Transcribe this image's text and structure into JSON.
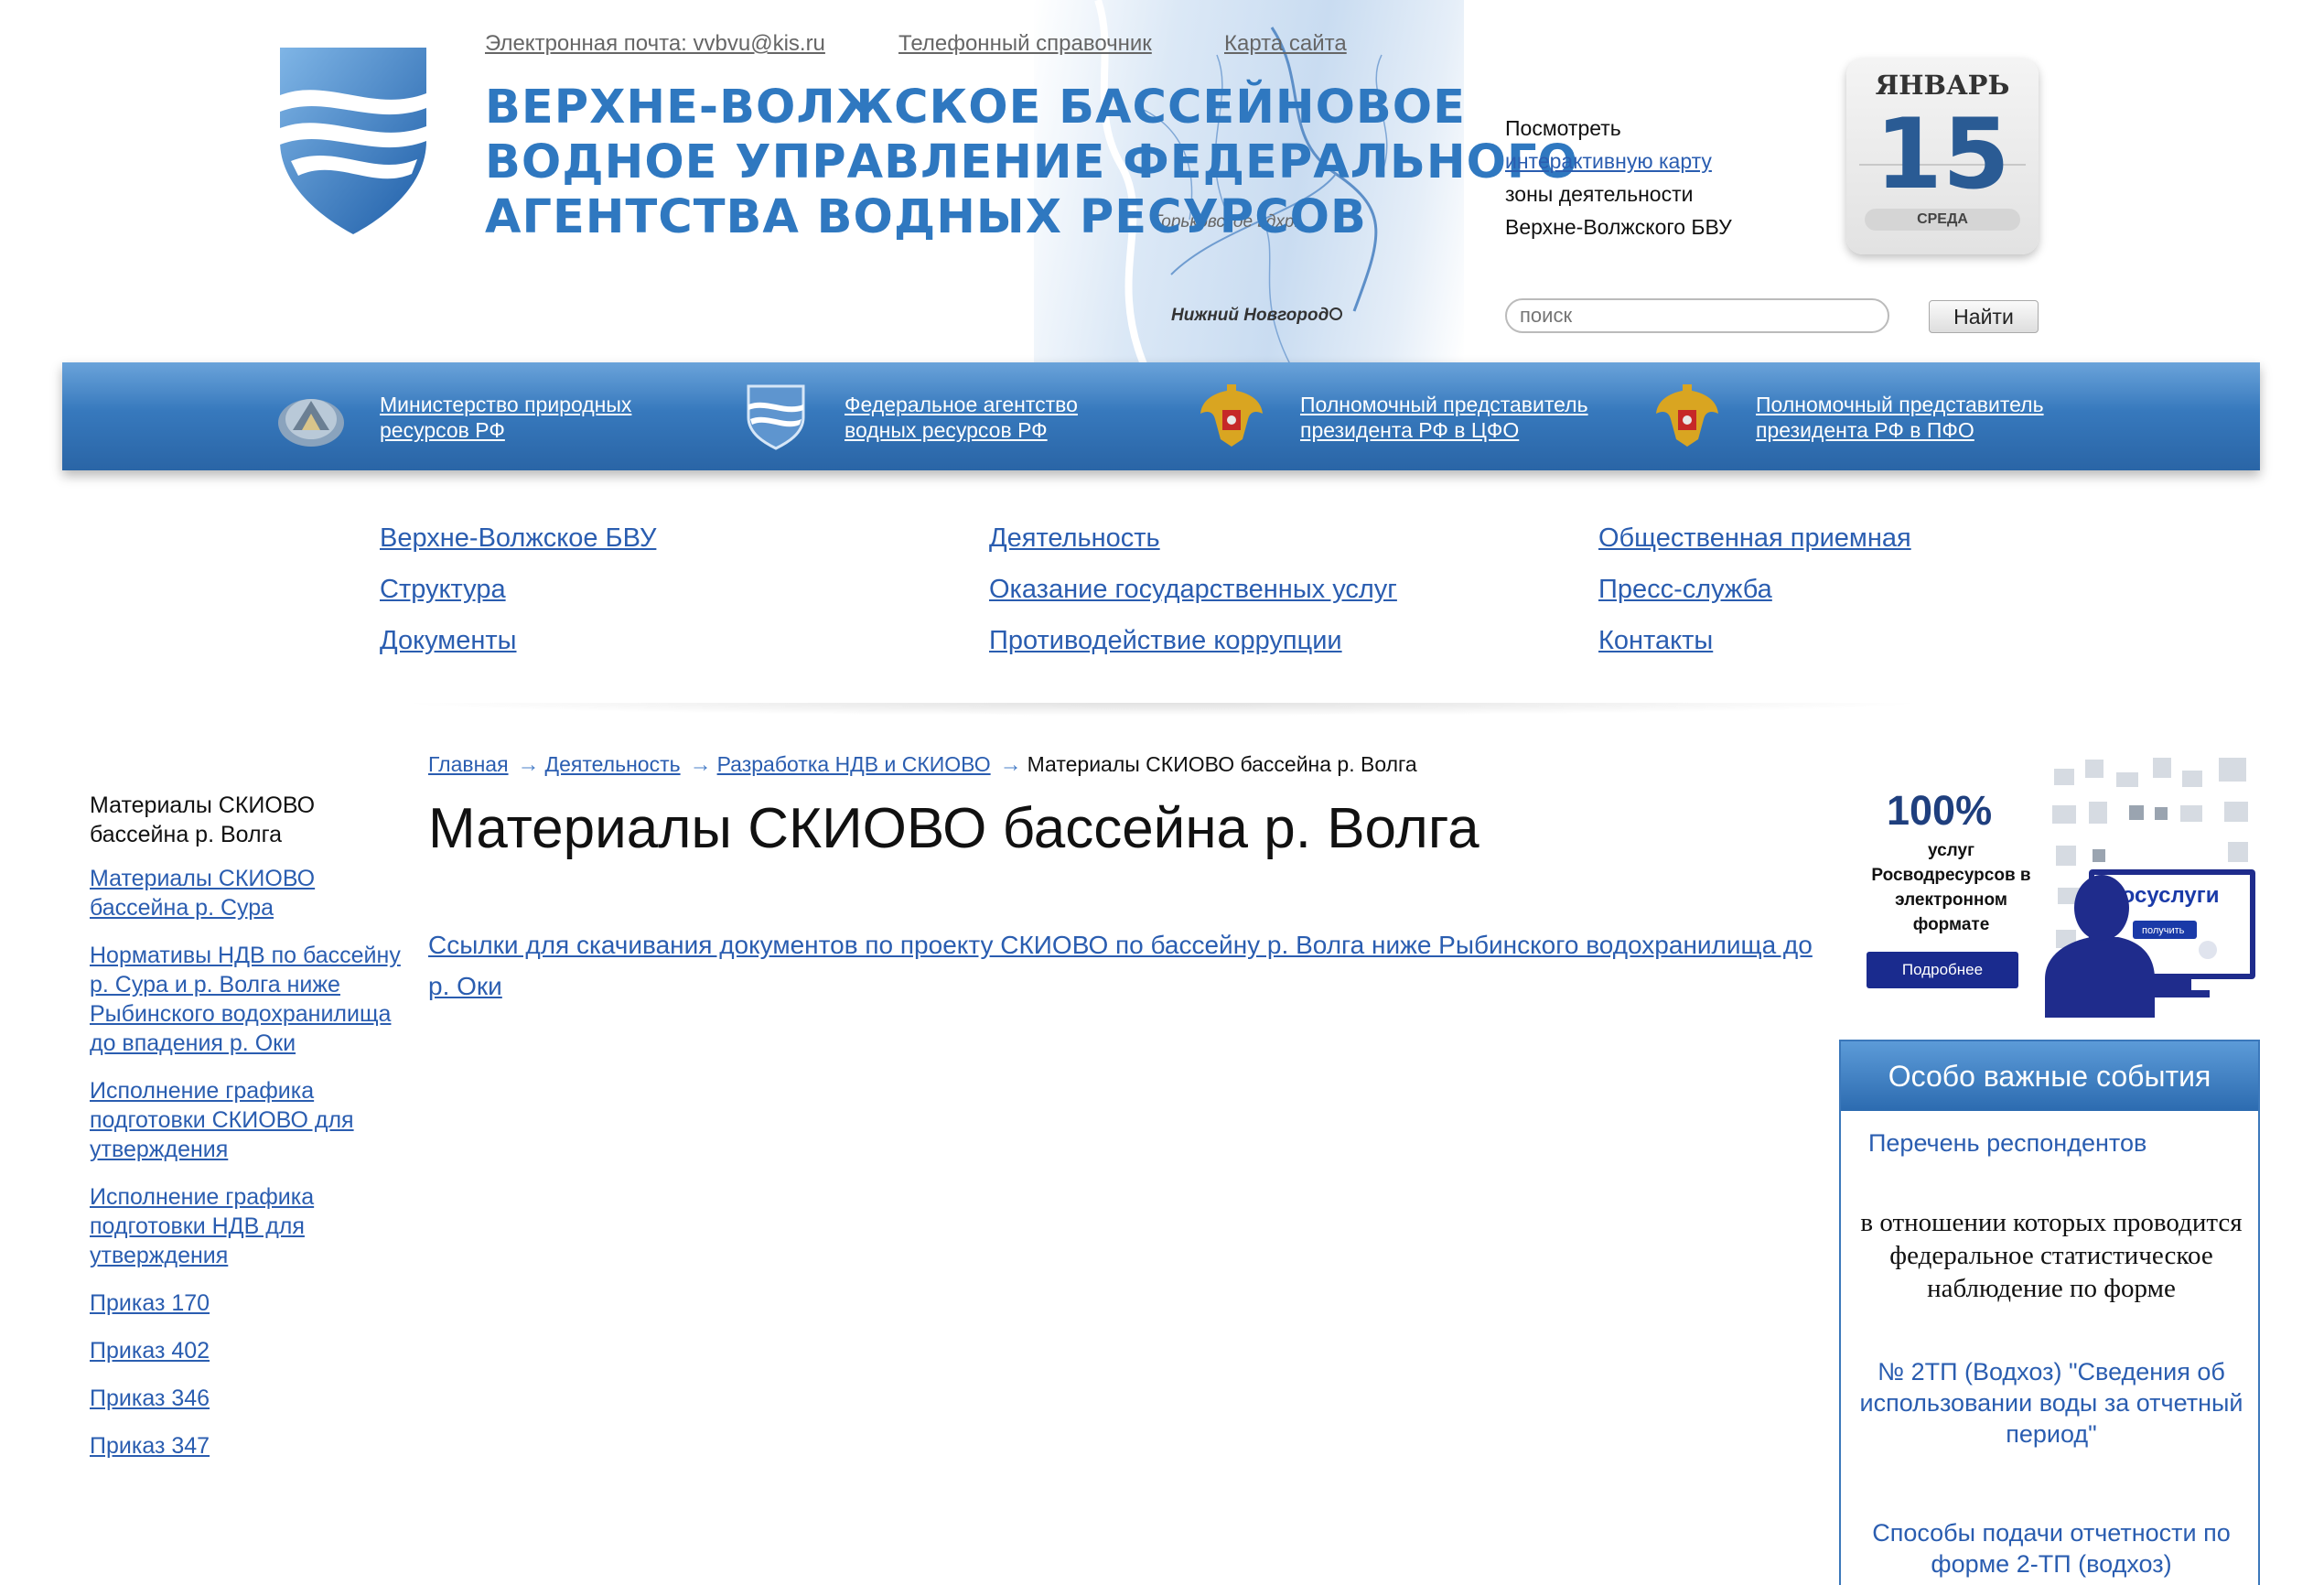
{
  "header": {
    "email_link": "Электронная почта: vvbvu@kis.ru",
    "phonebook_link": "Телефонный справочник",
    "sitemap_link": "Карта сайта",
    "title_lines": [
      "ВЕРХНЕ-ВОЛЖСКОЕ БАССЕЙНОВОЕ",
      "ВОДНОЕ УПРАВЛЕНИЕ ФЕДЕРАЛЬНОГО",
      "АГЕНТСТВА ВОДНЫХ РЕСУРСОВ"
    ],
    "map_labels": {
      "city": "Нижний Новгород",
      "reservoir": "Горьковское вдхр."
    },
    "map_info": {
      "line1": "Посмотреть",
      "link": "интерактивную карту",
      "line3": "зоны деятельности",
      "line4": "Верхне-Волжского БВУ"
    },
    "calendar": {
      "month": "ЯНВАРЬ",
      "day": "15",
      "weekday": "СРЕДА"
    },
    "search": {
      "placeholder": "поиск",
      "button": "Найти"
    },
    "colors": {
      "title": "#2f78c0",
      "link": "#2a5db0"
    }
  },
  "partners": [
    {
      "icon": "ministry-emblem-icon",
      "line1": "Министерство природных",
      "line2": "ресурсов РФ"
    },
    {
      "icon": "agency-shield-icon",
      "line1": "Федеральное агентство",
      "line2": "водных ресурсов РФ"
    },
    {
      "icon": "coat-of-arms-icon",
      "line1": "Полномочный представитель",
      "line2": "президента РФ в ЦФО"
    },
    {
      "icon": "coat-of-arms-icon",
      "line1": "Полномочный представитель",
      "line2": "президента РФ в ПФО"
    }
  ],
  "nav": {
    "col1": [
      "Верхне-Волжское БВУ",
      "Структура",
      "Документы"
    ],
    "col2": [
      "Деятельность",
      "Оказание государственных услуг",
      "Противодействие коррупции"
    ],
    "col3": [
      "Общественная приемная",
      "Пресс-служба",
      "Контакты"
    ]
  },
  "sidebar": {
    "current": "Материалы СКИОВО бассейна р. Волга",
    "items": [
      "Материалы СКИОВО бассейна р. Сура",
      "Нормативы НДВ по бассейну р. Сура и р. Волга ниже Рыбинского водохранилища до впадения р. Оки",
      "Исполнение графика подготовки СКИОВО для утверждения",
      "Исполнение графика подготовки НДВ для утверждения",
      "Приказ 170",
      "Приказ 402",
      "Приказ 346",
      "Приказ 347"
    ]
  },
  "breadcrumb": {
    "items": [
      "Главная",
      "Деятельность",
      "Разработка НДВ и СКИОВО"
    ],
    "current": "Материалы СКИОВО бассейна р. Волга"
  },
  "content": {
    "title": "Материалы СКИОВО бассейна р. Волга",
    "link": "Ссылки для скачивания документов по проекту СКИОВО по бассейну р. Волга ниже Рыбинского водохранилища до р. Оки"
  },
  "gosuslugi_banner": {
    "percent": "100%",
    "desc": "услуг Росводресурсов в электронном формате",
    "button": "Подробнее",
    "logo": "госуслуги",
    "small_button": "получить",
    "brand_color": "#1a2b8e"
  },
  "events": {
    "title": "Особо важные события",
    "item1": "Перечень респондентов",
    "item2": "в отношении которых проводится федеральное статистическое наблюдение по форме",
    "item3": "№ 2ТП (Водхоз) \"Сведения об использовании воды за отчетный период\"",
    "item4": "Способы подачи отчетности по форме 2-ТП (водхоз)"
  }
}
